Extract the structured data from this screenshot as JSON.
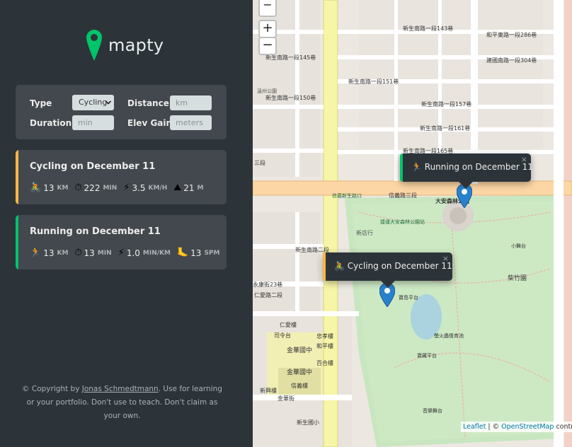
{
  "app": {
    "name": "mapty"
  },
  "form": {
    "type_label": "Type",
    "type_value": "Cycling",
    "distance_label": "Distance",
    "distance_placeholder": "km",
    "duration_label": "Duration",
    "duration_placeholder": "min",
    "elev_label": "Elev Gain",
    "elev_placeholder": "meters"
  },
  "workouts": [
    {
      "title": "Cycling on December 11",
      "accent": "#ffb545",
      "stats": [
        {
          "icon": "cyclist-icon",
          "glyph": "🚴",
          "value": "13",
          "unit": "km"
        },
        {
          "icon": "stopwatch-icon",
          "glyph": "⏱",
          "value": "222",
          "unit": "min"
        },
        {
          "icon": "lightning-icon",
          "glyph": "⚡",
          "value": "3.5",
          "unit": "km/h"
        },
        {
          "icon": "mountain-icon",
          "glyph": "⛰",
          "value": "21",
          "unit": "m"
        }
      ]
    },
    {
      "title": "Running on December 11",
      "accent": "#00c46a",
      "stats": [
        {
          "icon": "runner-icon",
          "glyph": "🏃",
          "value": "13",
          "unit": "km"
        },
        {
          "icon": "stopwatch-icon",
          "glyph": "⏱",
          "value": "13",
          "unit": "min"
        },
        {
          "icon": "lightning-icon",
          "glyph": "⚡",
          "value": "1.0",
          "unit": "min/km"
        },
        {
          "icon": "footprint-icon",
          "glyph": "🦶",
          "value": "13",
          "unit": "spm"
        }
      ]
    }
  ],
  "copyright": {
    "prefix": "© Copyright by ",
    "author": "Jonas Schmedtmann",
    "suffix": ". Use for learning or your portfolio. Don't use to teach. Don't claim as your own."
  },
  "map": {
    "zoom_in": "+",
    "zoom_out": "−",
    "popups": [
      {
        "glyph": "🏃",
        "text": "Running on December 11",
        "accent": "#00c46a",
        "close": "×"
      },
      {
        "glyph": "🚴",
        "text": "Cycling on December 11",
        "accent": "#ffb545",
        "close": "×"
      }
    ],
    "attribution": {
      "leaflet": "Leaflet",
      "sep": " | © ",
      "osm": "OpenStreetMap",
      "suffix": " contributors"
    },
    "labels": [
      "新生南路一段143巷",
      "新生南路一段145巷",
      "新生南路一段151巷",
      "新生南路一段157巷",
      "新生南路一段161巷",
      "新生南路一段165巷",
      "新生南路一段150巷",
      "和平東路一段286巷",
      "建國南路一段304巷",
      "信義路三段",
      "大安森林公園",
      "捷運大安森林公園站",
      "新店行",
      "寶島平台",
      "金華國中",
      "金華街",
      "新生國小",
      "永康街23巷",
      "新生南路二段",
      "信義新生路口",
      "溫州公園",
      "音樂舞台",
      "小舞台",
      "柴竹園",
      "螢火蟲復育池",
      "寶藏平台",
      "仁愛樓",
      "忠孝樓",
      "和平樓",
      "百合樓",
      "信義樓",
      "司令台",
      "新興樓",
      "三段",
      "仁愛路二段",
      "金華國中"
    ]
  }
}
